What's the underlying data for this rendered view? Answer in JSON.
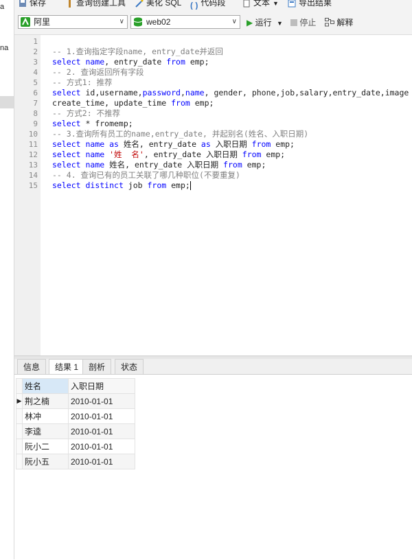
{
  "left_panel": {
    "fragment_top": "a",
    "fragment_mid": "na"
  },
  "toolbar": {
    "save": "保存",
    "query_builder": "查询创建工具",
    "beautify_sql": "美化 SQL",
    "snippet": "代码段",
    "text": "文本",
    "export": "导出结果"
  },
  "connection": {
    "server": "阿里",
    "database": "web02",
    "run": "运行",
    "stop": "停止",
    "explain": "解释"
  },
  "editor": {
    "line_numbers": [
      "1",
      "2",
      "3",
      "4",
      "5",
      "6",
      "7",
      "8",
      "9",
      "10",
      "11",
      "12",
      "13",
      "14",
      "15"
    ],
    "lines": [
      [],
      [
        {
          "t": "-- 1.查询指定字段name, entry_date并返回",
          "c": "cm"
        }
      ],
      [
        {
          "t": "select",
          "c": "kw"
        },
        {
          "t": " "
        },
        {
          "t": "name",
          "c": "kw"
        },
        {
          "t": ", entry_date "
        },
        {
          "t": "from",
          "c": "kw"
        },
        {
          "t": " emp;"
        }
      ],
      [
        {
          "t": "-- 2. 查询返回所有字段",
          "c": "cm"
        }
      ],
      [
        {
          "t": "-- 方式1: 推荐",
          "c": "cm"
        }
      ],
      [
        {
          "t": "select",
          "c": "kw"
        },
        {
          "t": " id,username,"
        },
        {
          "t": "password",
          "c": "kw"
        },
        {
          "t": ","
        },
        {
          "t": "name",
          "c": "kw"
        },
        {
          "t": ", gender, phone,job,salary,entry_date,image"
        }
      ],
      [
        {
          "t": "create_time, update_time "
        },
        {
          "t": "from",
          "c": "kw"
        },
        {
          "t": " emp;"
        }
      ],
      [
        {
          "t": "-- 方式2: 不推荐",
          "c": "cm"
        }
      ],
      [
        {
          "t": "select",
          "c": "kw"
        },
        {
          "t": " * fromemp;"
        }
      ],
      [
        {
          "t": "-- 3.查询所有员工的name,entry_date, 并起别名(姓名、入职日期)",
          "c": "cm"
        }
      ],
      [
        {
          "t": "select",
          "c": "kw"
        },
        {
          "t": " "
        },
        {
          "t": "name",
          "c": "kw"
        },
        {
          "t": " "
        },
        {
          "t": "as",
          "c": "kw"
        },
        {
          "t": " 姓名, entry_date "
        },
        {
          "t": "as",
          "c": "kw"
        },
        {
          "t": " 入职日期 "
        },
        {
          "t": "from",
          "c": "kw"
        },
        {
          "t": " emp;"
        }
      ],
      [
        {
          "t": "select",
          "c": "kw"
        },
        {
          "t": " "
        },
        {
          "t": "name",
          "c": "kw"
        },
        {
          "t": " "
        },
        {
          "t": "'姓  名'",
          "c": "st"
        },
        {
          "t": ", entry_date 入职日期 "
        },
        {
          "t": "from",
          "c": "kw"
        },
        {
          "t": " emp;"
        }
      ],
      [
        {
          "t": "select",
          "c": "kw"
        },
        {
          "t": " "
        },
        {
          "t": "name",
          "c": "kw"
        },
        {
          "t": " 姓名, entry_date 入职日期 "
        },
        {
          "t": "from",
          "c": "kw"
        },
        {
          "t": " emp;"
        }
      ],
      [
        {
          "t": "-- 4. 查询已有的员工关联了哪几种职位(不要重复)",
          "c": "cm"
        }
      ],
      [
        {
          "t": "select",
          "c": "kw"
        },
        {
          "t": " "
        },
        {
          "t": "distinct",
          "c": "kw"
        },
        {
          "t": " job "
        },
        {
          "t": "from",
          "c": "kw"
        },
        {
          "t": " emp;"
        }
      ]
    ]
  },
  "tabs": [
    {
      "label": "信息",
      "active": false
    },
    {
      "label": "结果 1",
      "active": true
    },
    {
      "label": "剖析",
      "active": false
    },
    {
      "label": "状态",
      "active": false
    }
  ],
  "results": {
    "columns": [
      "姓名",
      "入职日期"
    ],
    "rows": [
      [
        "荆之楠",
        "2010-01-01"
      ],
      [
        "林冲",
        "2010-01-01"
      ],
      [
        "李逵",
        "2010-01-01"
      ],
      [
        "阮小二",
        "2010-01-01"
      ],
      [
        "阮小五",
        "2010-01-01"
      ]
    ],
    "current_row_marker": "▶"
  },
  "colors": {
    "keyword": "#0000ff",
    "comment": "#808080",
    "string": "#c00000",
    "run_green": "#2aa02a"
  }
}
